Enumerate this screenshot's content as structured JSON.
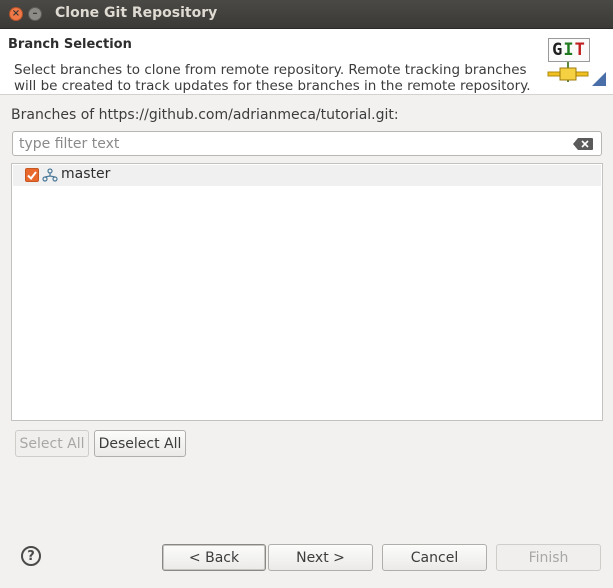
{
  "window": {
    "title": "Clone Git Repository",
    "close_icon": "close-icon",
    "minimize_icon": "minimize-icon"
  },
  "header": {
    "title": "Branch Selection",
    "description": "Select branches to clone from remote repository. Remote tracking branches will be created to track updates for these branches in the remote repository.",
    "logo_text": [
      "G",
      "I",
      "T"
    ]
  },
  "branches": {
    "label": "Branches of https://github.com/adrianmeca/tutorial.git:",
    "filter_placeholder": "type filter text",
    "filter_value": "",
    "items": [
      {
        "name": "master",
        "checked": true
      }
    ]
  },
  "selection_buttons": {
    "select_all": "Select All",
    "deselect_all": "Deselect All"
  },
  "footer": {
    "back": "< Back",
    "next": "Next >",
    "cancel": "Cancel",
    "finish": "Finish",
    "help_icon": "help-icon"
  },
  "colors": {
    "checkbox": "#e9692c",
    "titlebar": "#3b3a36",
    "close_button": "#f07746"
  }
}
